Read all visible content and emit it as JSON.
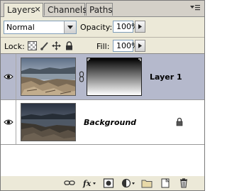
{
  "tabs": [
    {
      "label": "Layers",
      "active": true
    },
    {
      "label": "Channels",
      "active": false
    },
    {
      "label": "Paths",
      "active": false
    }
  ],
  "blend_mode": {
    "value": "Normal"
  },
  "opacity": {
    "label": "Opacity:",
    "value": "100%"
  },
  "lock": {
    "label": "Lock:"
  },
  "fill": {
    "label": "Fill:",
    "value": "100%"
  },
  "layers": [
    {
      "name": "Layer 1",
      "visible": true,
      "selected": true,
      "has_mask": true
    },
    {
      "name": "Background",
      "visible": true,
      "selected": false,
      "locked": true
    }
  ],
  "colors": {
    "selected_row": "#b5b9cc",
    "panel_bg": "#ece9d8",
    "list_bg": "#ffffff"
  },
  "bottom_icons": [
    "link-icon",
    "fx-icon",
    "add-mask-icon",
    "adjustment-layer-icon",
    "new-group-icon",
    "new-layer-icon",
    "delete-icon"
  ]
}
